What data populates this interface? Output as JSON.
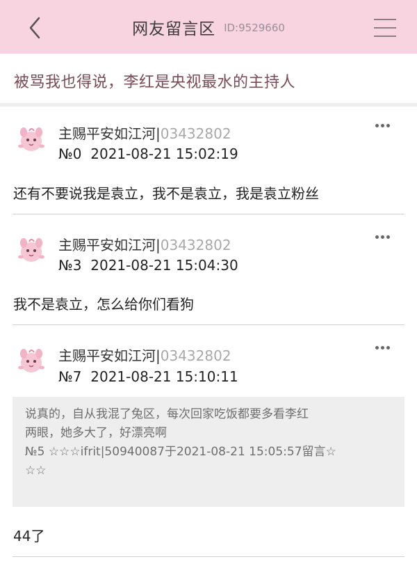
{
  "header": {
    "title": "网友留言区",
    "id_label": "ID:9529660",
    "back_icon": "chevron-left-icon",
    "menu_icon": "hamburger-menu-icon"
  },
  "page": {
    "heading": "被骂我也得说，李红是央视最水的主持人"
  },
  "posts": [
    {
      "author": "主赐平安如江河|",
      "uid": "03432802",
      "number": "№0",
      "datetime": "2021-08-21 15:02:19",
      "content": "还有不要说我是袁立，我不是袁立，我是袁立粉丝"
    },
    {
      "author": "主赐平安如江河|",
      "uid": "03432802",
      "number": "№3",
      "datetime": "2021-08-21 15:04:30",
      "content": "我不是袁立，怎么给你们看狗"
    },
    {
      "author": "主赐平安如江河|",
      "uid": "03432802",
      "number": "№7",
      "datetime": "2021-08-21 15:10:11",
      "quote": {
        "line1": "说真的，自从我混了兔区，每次回家吃饭都要多看李红",
        "line2": "两眼，她多大了，好漂亮啊",
        "line3": "№5 ☆☆☆ifrit|50940087于2021-08-21 15:05:57留言☆",
        "line4": "☆☆"
      },
      "content": "44了"
    }
  ],
  "colors": {
    "header_bg": "#f8d3e0",
    "heading_text": "#7b4a57",
    "quote_bg": "#eeeeee"
  }
}
